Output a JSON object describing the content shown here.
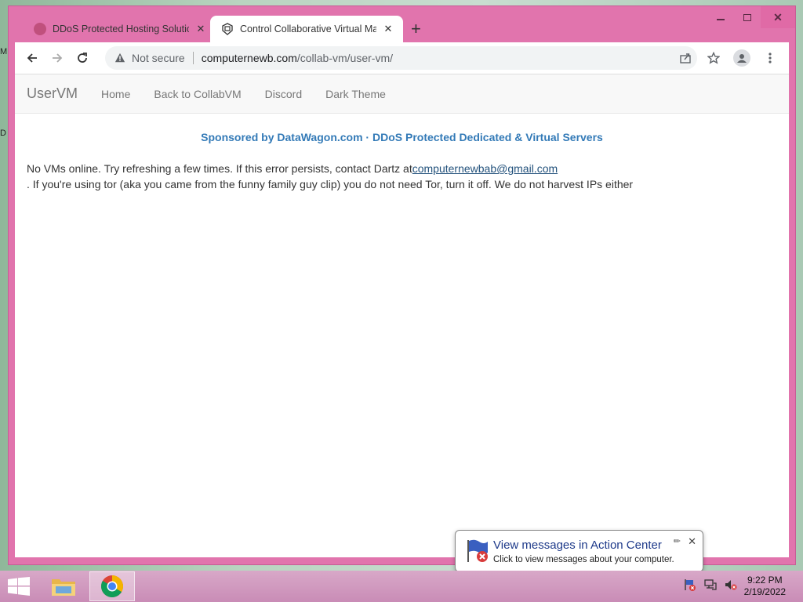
{
  "desktop": {
    "edge_letters": [
      "M",
      "D"
    ]
  },
  "browser": {
    "tabs": [
      {
        "title": "DDoS Protected Hosting Solutions",
        "active": false
      },
      {
        "title": "Control Collaborative Virtual Machines",
        "active": true
      }
    ],
    "address": {
      "security_label": "Not secure",
      "host": "computernewb.com",
      "path": "/collab-vm/user-vm/"
    }
  },
  "page": {
    "navbar": {
      "brand": "UserVM",
      "links": [
        "Home",
        "Back to CollabVM",
        "Discord",
        "Dark Theme"
      ]
    },
    "sponsor": "Sponsored by DataWagon.com · DDoS Protected Dedicated & Virtual Servers",
    "message": {
      "prefix": "No VMs online. Try refreshing a few times. If this error persists, contact Dartz at",
      "email": "computernewbab@gmail.com",
      "suffix": ". If you're using tor (aka you came from the funny family guy clip) you do not need Tor, turn it off. We do not harvest IPs either"
    }
  },
  "notification": {
    "title": "View messages in Action Center",
    "body": "Click to view messages about your computer."
  },
  "taskbar": {
    "time": "9:22 PM",
    "date": "2/19/2022"
  },
  "colors": {
    "window_frame": "#e174ad",
    "link_blue": "#337ab7",
    "navbar_text": "#777777"
  }
}
